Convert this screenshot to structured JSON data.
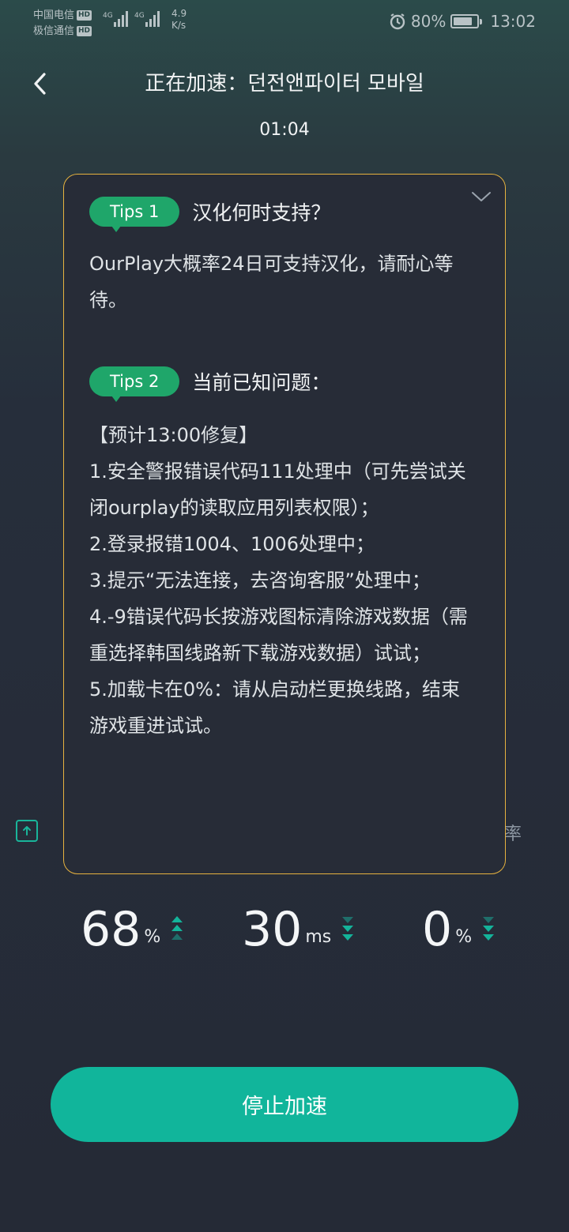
{
  "status_bar": {
    "carrier1": "中国电信",
    "carrier2": "极信通信",
    "hd_badge": "HD",
    "net_speed_value": "4.9",
    "net_speed_unit": "K/s",
    "battery_percent": "80%",
    "battery_level": 0.8,
    "time": "13:02",
    "icons": [
      "signal-icon",
      "alarm-icon",
      "battery-icon"
    ]
  },
  "header": {
    "title": "正在加速：던전앤파이터 모바일",
    "timer": "01:04"
  },
  "tips": [
    {
      "badge": "Tips 1",
      "heading": "汉化何时支持？",
      "lines": [
        "OurPlay大概率24日可支持汉化，请耐心等待。"
      ]
    },
    {
      "badge": "Tips 2",
      "heading": "当前已知问题：",
      "lines": [
        "【预计13:00修复】",
        "1.安全警报错误代码111处理中（可先尝试关闭ourplay的读取应用列表权限）；",
        "2.登录报错1004、1006处理中；",
        "3.提示“无法连接，去咨询客服”处理中；",
        "4.-9错误代码长按游戏图标清除游戏数据（需重选择韩国线路新下载游戏数据）试试；",
        "5.加载卡在0%：请从启动栏更换线路，结束游戏重进试试。"
      ]
    }
  ],
  "partial_label": "率",
  "stats": [
    {
      "value": "68",
      "unit": "%",
      "trend": "up"
    },
    {
      "value": "30",
      "unit": "ms",
      "trend": "down"
    },
    {
      "value": "0",
      "unit": "%",
      "trend": "down"
    }
  ],
  "colors": {
    "accent": "#11b59b",
    "badge": "#1fa66a",
    "panel_border": "#e6b23f"
  },
  "stop_button_label": "停止加速"
}
